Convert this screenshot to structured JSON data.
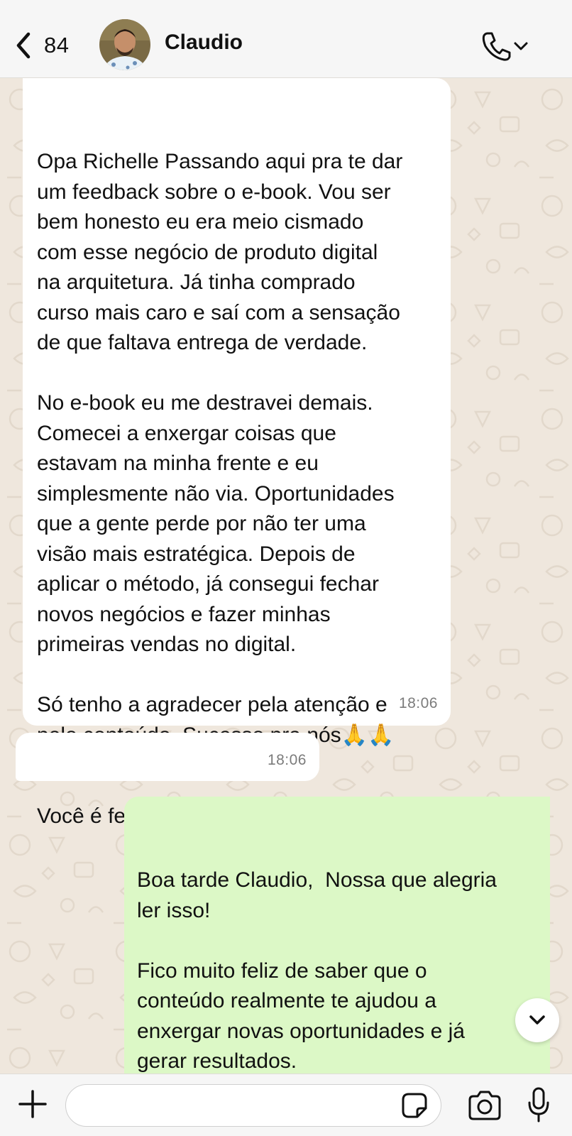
{
  "header": {
    "back_count": "84",
    "contact_name": "Claudio"
  },
  "messages": [
    {
      "direction": "incoming",
      "text": "Opa Richelle Passando aqui pra te dar\num feedback sobre o e-book. Vou ser\nbem honesto eu era meio cismado\ncom esse negócio de produto digital\nna arquitetura. Já tinha comprado\ncurso mais caro e saí com a sensação\nde que faltava entrega de verdade.\n\nNo e-book eu me destravei demais.\nComecei a enxergar coisas que\nestavam na minha frente e eu\nsimplesmente não via. Oportunidades\nque a gente perde por não ter uma\nvisão mais estratégica. Depois de\naplicar o método, já consegui fechar\nnovos negócios e fazer minhas\nprimeiras vendas no digital.\n\nSó tenho a agradecer pela atenção e\npelo conteúdo. Sucesso pra nós🙏🙏",
      "time": "18:06"
    },
    {
      "direction": "incoming",
      "text": "Você é fera de mais",
      "time": "18:06"
    },
    {
      "direction": "outgoing",
      "text": "Boa tarde Claudio,  Nossa que alegria\nler isso!\n\nFico muito feliz de saber que o\nconteúdo realmente te ajudou a\nenxergar novas oportunidades e já\ngerar resultados.\n\nMeu propósito é exatamente esse"
    }
  ],
  "input": {
    "value": ""
  },
  "icons": {
    "back": "chevron-left-icon",
    "call": "phone-icon",
    "scroll": "chevron-down-icon",
    "plus": "plus-icon",
    "sticker": "sticker-icon",
    "camera": "camera-icon",
    "mic": "microphone-icon"
  },
  "colors": {
    "incoming_bubble": "#ffffff",
    "outgoing_bubble": "#dcf8c6",
    "wallpaper": "#efe7dd",
    "bar": "#f6f6f6"
  }
}
